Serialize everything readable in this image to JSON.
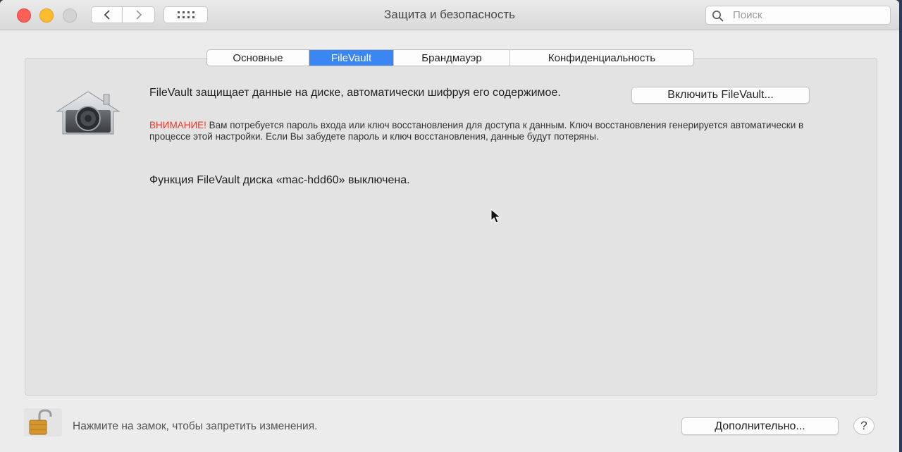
{
  "window": {
    "title": "Защита и безопасность"
  },
  "search": {
    "placeholder": "Поиск"
  },
  "tabs": [
    {
      "label": "Основные",
      "active": false
    },
    {
      "label": "FileVault",
      "active": true
    },
    {
      "label": "Брандмауэр",
      "active": false
    },
    {
      "label": "Конфиденциальность",
      "active": false
    }
  ],
  "filevault": {
    "heading": "FileVault защищает данные на диске, автоматически шифруя его содержимое.",
    "warning_label": "ВНИМАНИЕ!",
    "warning_text": " Вам потребуется пароль входа или ключ восстановления для доступа к данным. Ключ восстановления генерируется автоматически в процессе этой настройки. Если Вы забудете пароль и ключ восстановления, данные будут потеряны.",
    "status": "Функция FileVault диска «mac-hdd60» выключена.",
    "enable_button": "Включить FileVault..."
  },
  "footer": {
    "lock_text": "Нажмите на замок, чтобы запретить изменения.",
    "advanced_button": "Дополнительно...",
    "help_button": "?"
  },
  "icons": {
    "back": "chevron-left-icon",
    "forward": "chevron-right-icon",
    "show_all": "grid-icon",
    "search": "magnifier-icon",
    "filevault": "house-safe-icon",
    "lock": "padlock-open-icon"
  },
  "colors": {
    "accent": "#3a87f4",
    "warning": "#e23b2e",
    "close": "#fc5f57",
    "minimize": "#fdbc2e"
  }
}
